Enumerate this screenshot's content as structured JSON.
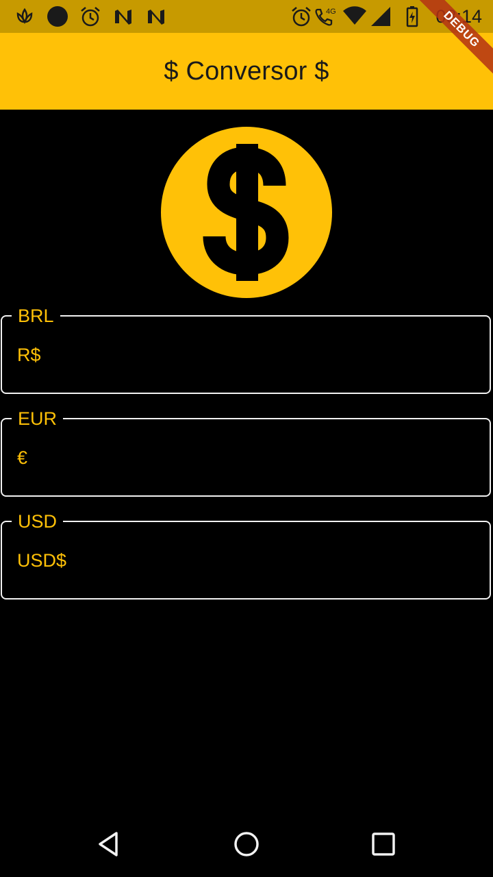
{
  "status_bar": {
    "time": "08:14",
    "network": "4G",
    "bar_color": "#C79A00"
  },
  "debug_banner": "DEBUG",
  "app_bar": {
    "title": "$ Conversor $",
    "color": "#FFC107"
  },
  "coin_icon": "monetization-icon",
  "fields": [
    {
      "label": "BRL",
      "prefix": "R$",
      "value": ""
    },
    {
      "label": "EUR",
      "prefix": "€",
      "value": ""
    },
    {
      "label": "USD",
      "prefix": "USD$",
      "value": ""
    }
  ],
  "nav": {
    "back": "back-icon",
    "home": "home-icon",
    "recents": "recents-icon"
  },
  "accent_color": "#FFC107"
}
